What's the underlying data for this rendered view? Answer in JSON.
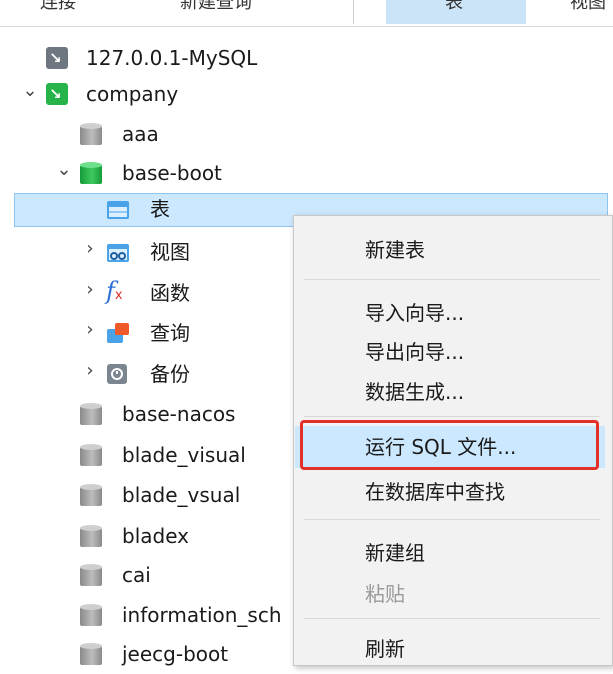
{
  "toolbar": {
    "items": [
      "连接",
      "新建查询",
      "表",
      "视图"
    ]
  },
  "tree": {
    "connection": "127.0.0.1-MySQL",
    "connection2": "company",
    "databases_top": [
      "aaa",
      "base-boot"
    ],
    "objects": [
      "表",
      "视图",
      "函数",
      "查询",
      "备份"
    ],
    "databases_bottom": [
      "base-nacos",
      "blade_visual",
      "blade_vsual",
      "bladex",
      "cai",
      "information_sch",
      "jeecg-boot"
    ]
  },
  "menu": {
    "items": [
      "新建表",
      "导入向导...",
      "导出向导...",
      "数据生成...",
      "运行 SQL 文件...",
      "在数据库中查找",
      "新建组",
      "粘贴",
      "刷新"
    ]
  },
  "icons": {
    "chevron_expanded": "chevron-down-icon",
    "chevron_collapsed": "chevron-right-icon"
  },
  "colors": {
    "selection": "#cce8ff",
    "highlight_border": "#e0322a",
    "active_db": "#26b44a"
  }
}
